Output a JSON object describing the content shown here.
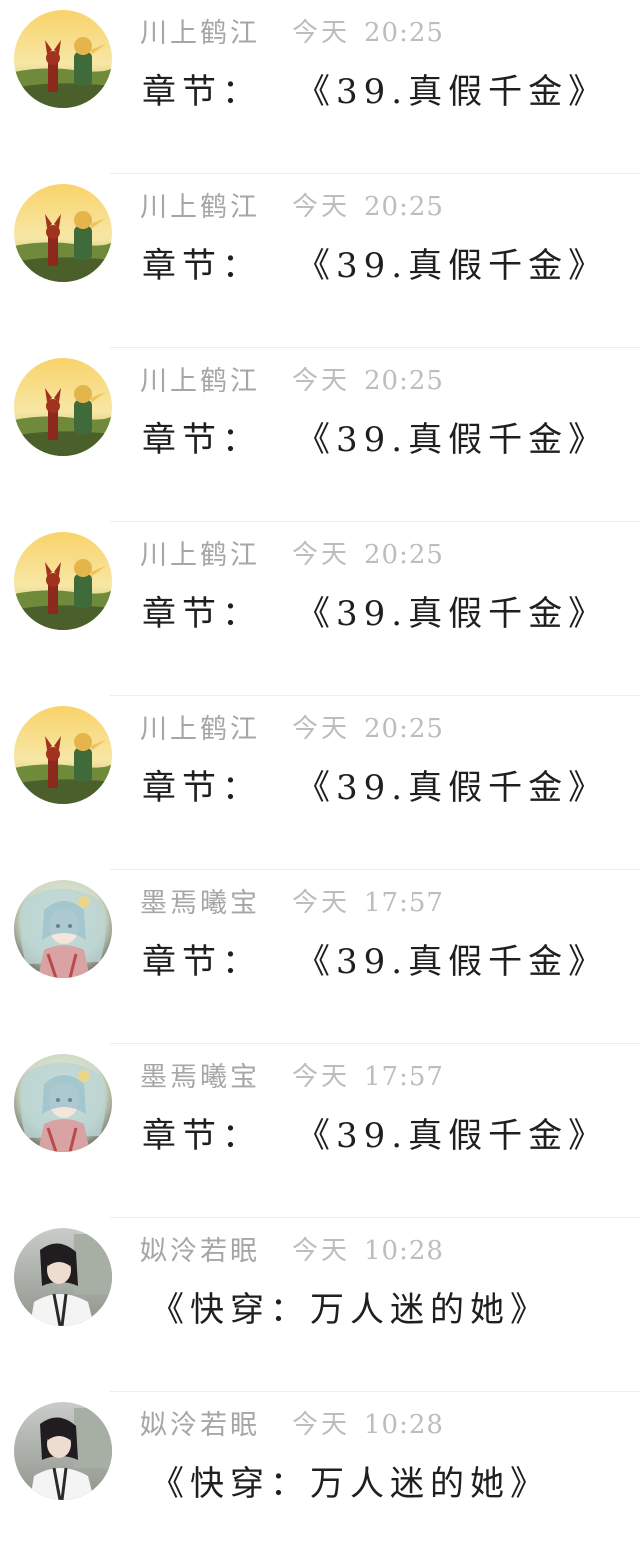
{
  "comments": [
    {
      "avatar": "little-prince-avatar",
      "name": "川上鹤江",
      "day": "今天",
      "time": "20:25",
      "label": "章节：",
      "text": "《39.真假千金》"
    },
    {
      "avatar": "little-prince-avatar",
      "name": "川上鹤江",
      "day": "今天",
      "time": "20:25",
      "label": "章节：",
      "text": "《39.真假千金》"
    },
    {
      "avatar": "little-prince-avatar",
      "name": "川上鹤江",
      "day": "今天",
      "time": "20:25",
      "label": "章节：",
      "text": "《39.真假千金》"
    },
    {
      "avatar": "little-prince-avatar",
      "name": "川上鹤江",
      "day": "今天",
      "time": "20:25",
      "label": "章节：",
      "text": "《39.真假千金》"
    },
    {
      "avatar": "little-prince-avatar",
      "name": "川上鹤江",
      "day": "今天",
      "time": "20:25",
      "label": "章节：",
      "text": "《39.真假千金》"
    },
    {
      "avatar": "anime-girl-avatar",
      "name": "墨焉曦宝",
      "day": "今天",
      "time": "17:57",
      "label": "章节：",
      "text": "《39.真假千金》"
    },
    {
      "avatar": "anime-girl-avatar",
      "name": "墨焉曦宝",
      "day": "今天",
      "time": "17:57",
      "label": "章节：",
      "text": "《39.真假千金》"
    },
    {
      "avatar": "photo-girl-avatar",
      "name": "姒泠若眠",
      "day": "今天",
      "time": "10:28",
      "label": "",
      "text": "《快穿：万人迷的她》"
    },
    {
      "avatar": "photo-girl-avatar",
      "name": "姒泠若眠",
      "day": "今天",
      "time": "10:28",
      "label": "",
      "text": "《快穿：万人迷的她》"
    }
  ],
  "colors": {
    "name": "#a6a6a6",
    "time": "#bdbdbd",
    "message": "#1f1f1f",
    "divider": "#ededed"
  }
}
